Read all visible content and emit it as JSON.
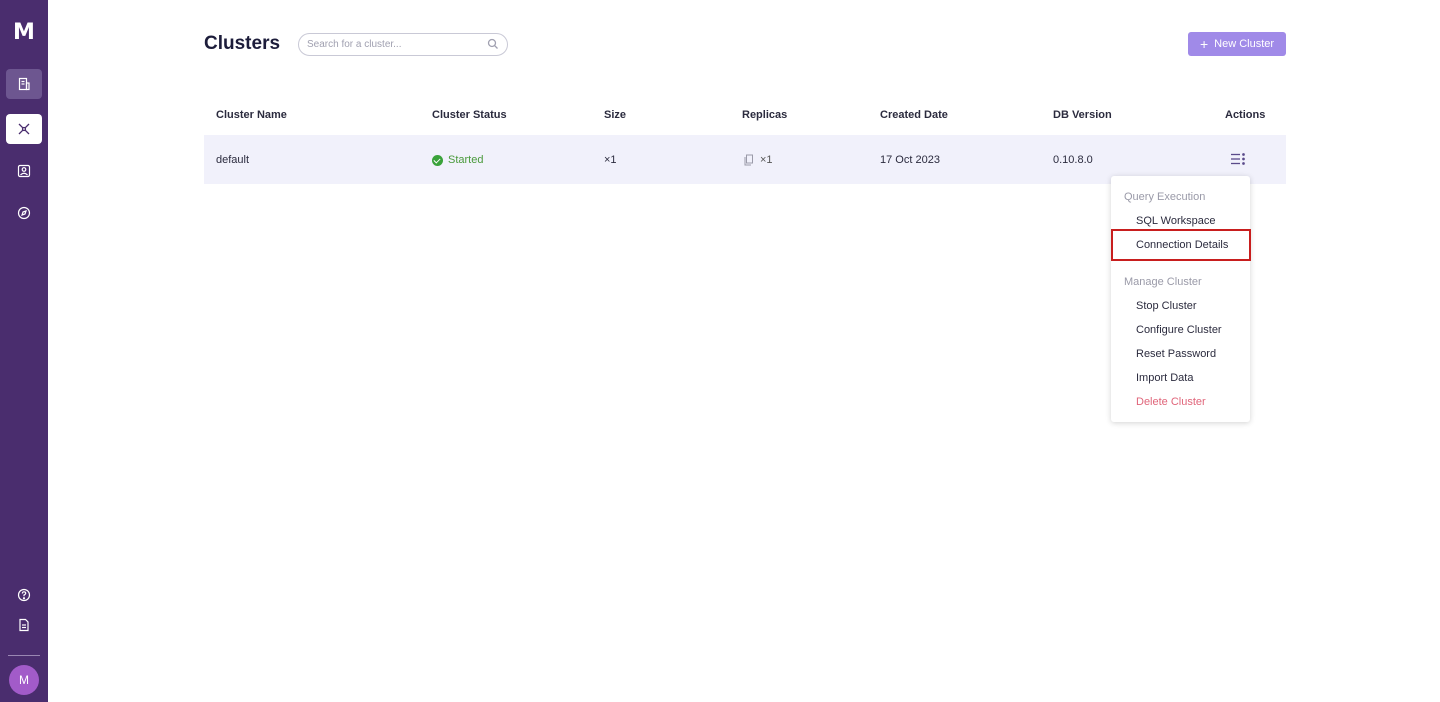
{
  "app": {
    "logo": "M"
  },
  "sidebar": {
    "items": [
      {
        "name": "documents-icon"
      },
      {
        "name": "clusters-icon"
      },
      {
        "name": "monitoring-icon"
      },
      {
        "name": "compass-icon"
      }
    ],
    "bottom": [
      {
        "name": "help-icon"
      },
      {
        "name": "docs-icon"
      }
    ],
    "avatar": "M"
  },
  "header": {
    "title": "Clusters",
    "search_placeholder": "Search for a cluster...",
    "new_button": "New Cluster"
  },
  "table": {
    "columns": [
      "Cluster Name",
      "Cluster Status",
      "Size",
      "Replicas",
      "Created Date",
      "DB Version",
      "Actions"
    ],
    "rows": [
      {
        "name": "default",
        "status": "Started",
        "size": "×1",
        "replicas": "×1",
        "created": "17 Oct 2023",
        "version": "0.10.8.0"
      }
    ]
  },
  "menu": {
    "sections": [
      {
        "header": "Query Execution",
        "items": [
          "SQL Workspace",
          "Connection Details"
        ]
      },
      {
        "header": "Manage Cluster",
        "items": [
          "Stop Cluster",
          "Configure Cluster",
          "Reset Password",
          "Import Data",
          "Delete Cluster"
        ]
      }
    ]
  },
  "colors": {
    "sidebar": "#4a2d6e",
    "accent": "#a08ae8",
    "status_ok": "#3aa23a",
    "danger": "#e0657a",
    "highlight": "#c81e1e"
  }
}
